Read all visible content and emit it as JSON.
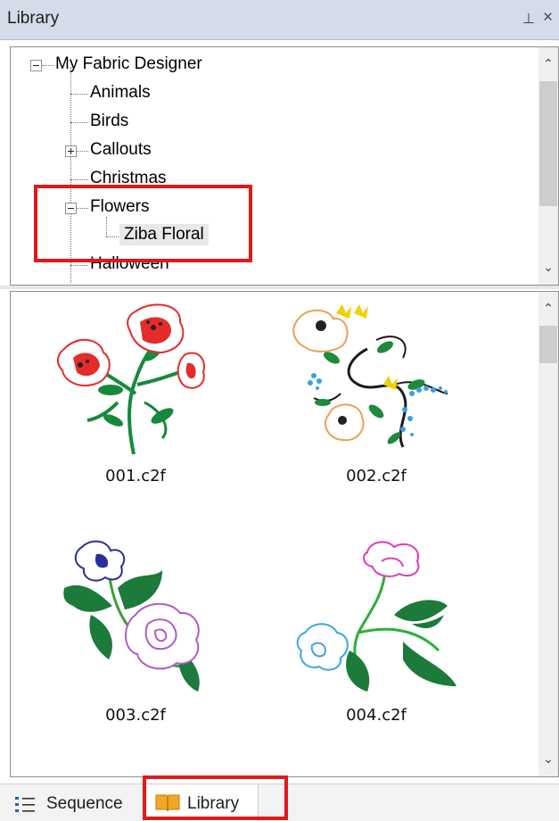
{
  "panel": {
    "title": "Library",
    "pin_glyph": "⊥",
    "close_glyph": "×"
  },
  "tree": {
    "root": "My Fabric Designer",
    "items": [
      {
        "label": "Animals",
        "expander": "none"
      },
      {
        "label": "Birds",
        "expander": "none"
      },
      {
        "label": "Callouts",
        "expander": "plus"
      },
      {
        "label": "Christmas",
        "expander": "none"
      },
      {
        "label": "Flowers",
        "expander": "minus",
        "children": [
          {
            "label": "Ziba Floral",
            "selected": true
          }
        ]
      },
      {
        "label": "Halloween",
        "expander": "none"
      }
    ]
  },
  "gallery": {
    "items": [
      {
        "caption": "001.c2f",
        "icon": "poppy-bouquet"
      },
      {
        "caption": "002.c2f",
        "icon": "poppy-swirl-vine"
      },
      {
        "caption": "003.c2f",
        "icon": "pansy-peony"
      },
      {
        "caption": "004.c2f",
        "icon": "carnation-leaf-vine"
      }
    ]
  },
  "tabs": [
    {
      "label": "Sequence",
      "icon": "list-icon",
      "active": false
    },
    {
      "label": "Library",
      "icon": "book-icon",
      "active": true
    }
  ],
  "colors": {
    "highlight": "#e0191b",
    "titlebar": "#d6dbe9"
  }
}
